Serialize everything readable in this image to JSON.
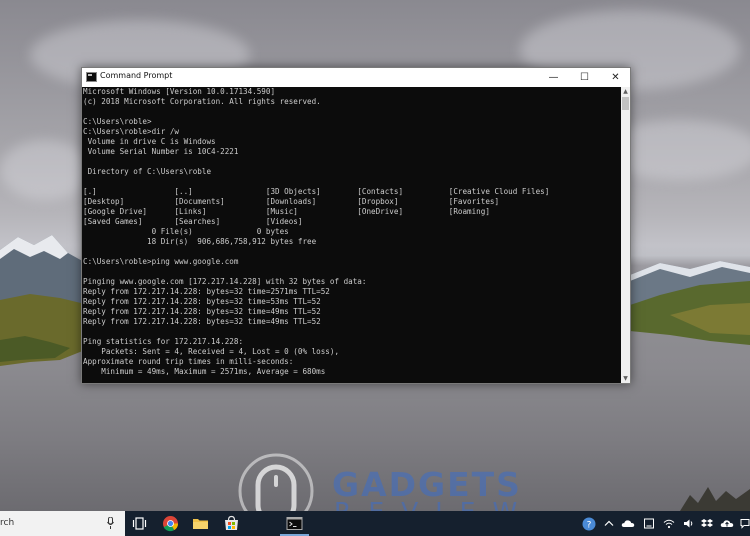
{
  "window": {
    "title": "Command Prompt",
    "controls": {
      "minimize": "—",
      "maximize": "☐",
      "close": "✕"
    }
  },
  "console": {
    "lines": [
      "Microsoft Windows [Version 10.0.17134.590]",
      "(c) 2018 Microsoft Corporation. All rights reserved.",
      "",
      "C:\\Users\\roble>",
      "C:\\Users\\roble>dir /w",
      " Volume in drive C is Windows",
      " Volume Serial Number is 10C4-2221",
      "",
      " Directory of C:\\Users\\roble",
      "",
      "[.]                 [..]                [3D Objects]        [Contacts]          [Creative Cloud Files]",
      "[Desktop]           [Documents]         [Downloads]         [Dropbox]           [Favorites]",
      "[Google Drive]      [Links]             [Music]             [OneDrive]          [Roaming]",
      "[Saved Games]       [Searches]          [Videos]",
      "               0 File(s)              0 bytes",
      "              18 Dir(s)  906,686,758,912 bytes free",
      "",
      "C:\\Users\\roble>ping www.google.com",
      "",
      "Pinging www.google.com [172.217.14.228] with 32 bytes of data:",
      "Reply from 172.217.14.228: bytes=32 time=2571ms TTL=52",
      "Reply from 172.217.14.228: bytes=32 time=53ms TTL=52",
      "Reply from 172.217.14.228: bytes=32 time=49ms TTL=52",
      "Reply from 172.217.14.228: bytes=32 time=49ms TTL=52",
      "",
      "Ping statistics for 172.217.14.228:",
      "    Packets: Sent = 4, Received = 4, Lost = 0 (0% loss),",
      "Approximate round trip times in milli-seconds:",
      "    Minimum = 49ms, Maximum = 2571ms, Average = 680ms"
    ]
  },
  "taskbar": {
    "search_text": "rch",
    "apps": [
      "task-view",
      "chrome",
      "file-explorer",
      "store",
      "command-prompt"
    ],
    "tray_icons": [
      "help",
      "onedrive",
      "tablet",
      "wifi",
      "volume",
      "dropbox",
      "cloud-upload"
    ]
  },
  "watermark": {
    "line1": "GADGETS",
    "line2": "REVIEW"
  },
  "colors": {
    "console_bg": "#0c0c0c",
    "console_text": "#cccccc",
    "taskbar_bg": "#15202e",
    "watermark": "#3c6ec8"
  }
}
